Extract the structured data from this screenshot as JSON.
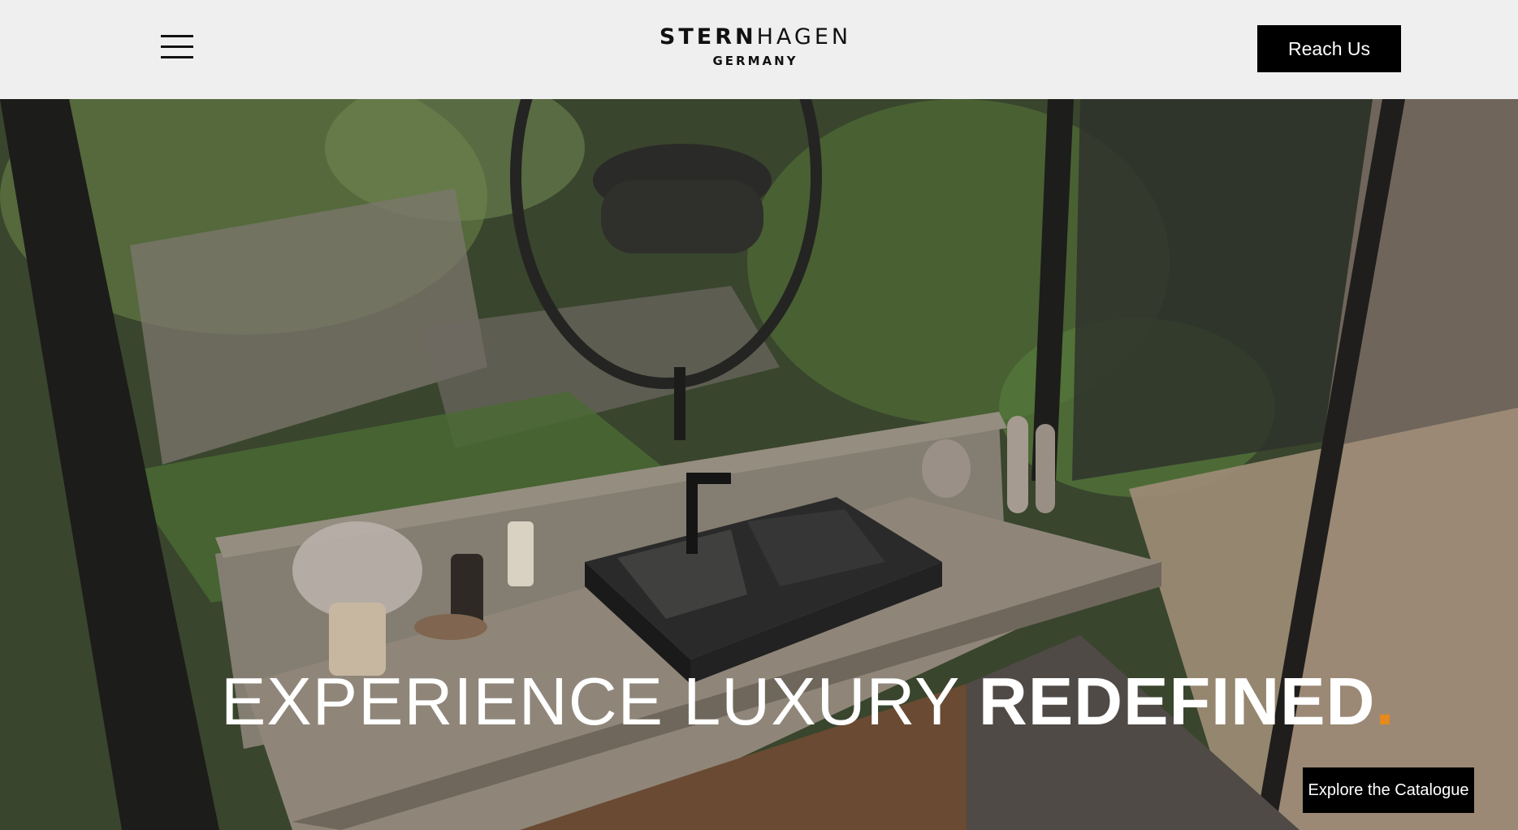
{
  "header": {
    "menu_icon": "hamburger-menu-icon",
    "logo": {
      "brand_bold": "STERN",
      "brand_light": "HAGEN",
      "country": "GERMANY"
    },
    "cta_label": "Reach Us"
  },
  "hero": {
    "headline_light": "EXPERIENCE LUXURY ",
    "headline_bold": "REDEFINED",
    "headline_dot": ".",
    "cta_label": "Explore the Catalogue",
    "accent_color": "#e8891c"
  }
}
